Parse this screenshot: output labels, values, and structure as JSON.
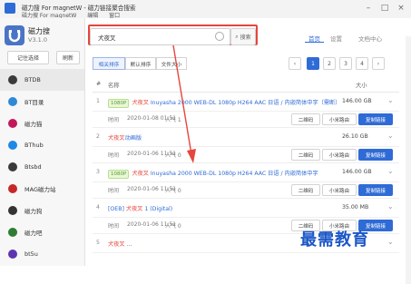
{
  "window": {
    "title": "磁力搜 For magnetW - 磁力链接聚合搜索",
    "menu": [
      "磁力搜 For magnetW",
      "编辑",
      "窗口"
    ]
  },
  "brand": {
    "name": "磁力搜",
    "version": "V3.1.0"
  },
  "side_buttons": {
    "remember": "记住选择",
    "refresh": "刷新"
  },
  "sources": [
    {
      "label": "BTDB",
      "color": "#3a3a3a"
    },
    {
      "label": "BT目录",
      "color": "#2f8ad6"
    },
    {
      "label": "磁力猫",
      "color": "#c2185b"
    },
    {
      "label": "BThub",
      "color": "#1e88e5"
    },
    {
      "label": "Btsbd",
      "color": "#3a3a3a"
    },
    {
      "label": "MAG磁力站",
      "color": "#c62828"
    },
    {
      "label": "磁力狗",
      "color": "#333333"
    },
    {
      "label": "磁力吧",
      "color": "#2e7d32"
    },
    {
      "label": "bt5u",
      "color": "#5e35b1"
    }
  ],
  "search": {
    "value": "犬夜叉",
    "button": "搜索"
  },
  "top_tabs": [
    "首页",
    "设置",
    "文档中心"
  ],
  "filters": [
    "相关排序",
    "默认排序",
    "文件大小"
  ],
  "pager": [
    "1",
    "2",
    "3",
    "4"
  ],
  "table": {
    "col_name": "名称",
    "col_size": "大小"
  },
  "meta_labels": {
    "time": "时间",
    "popularity": "人气",
    "qr": "二维码",
    "mi": "小米路由",
    "copy": "复制链接"
  },
  "rows": [
    {
      "idx": "1",
      "tag": "1080P",
      "hl": "犬夜叉",
      "rest": " Inuyasha 2000 WEB-DL 1080p H264 AAC 日语 / 内嵌简体中字（需断）",
      "size": "146.00 GB",
      "date": "2020-01-08 01:51",
      "pop": "1"
    },
    {
      "idx": "2",
      "tag": "",
      "hl": "犬夜叉",
      "rest": "动画版",
      "size": "26.10 GB",
      "date": "2020-01-06 11:51",
      "pop": "0"
    },
    {
      "idx": "3",
      "tag": "1080P",
      "hl": "犬夜叉",
      "rest": " Inuyasha 2000 WEB-DL 1080p H264 AAC 日语 / 内嵌简体中字",
      "size": "146.00 GB",
      "date": "2020-01-06 11:51",
      "pop": "0"
    },
    {
      "idx": "4",
      "tag": "",
      "hl": "犬夜叉",
      "rest": " 1 (Digital)",
      "prefix": "[OEB] ",
      "size": "35.00 MB",
      "date": "2020-01-06 11:51",
      "pop": "0"
    },
    {
      "idx": "5",
      "tag": "",
      "hl": "犬夜叉",
      "rest": " ...",
      "size": "",
      "date": "",
      "pop": ""
    }
  ],
  "watermark": "最需教育"
}
